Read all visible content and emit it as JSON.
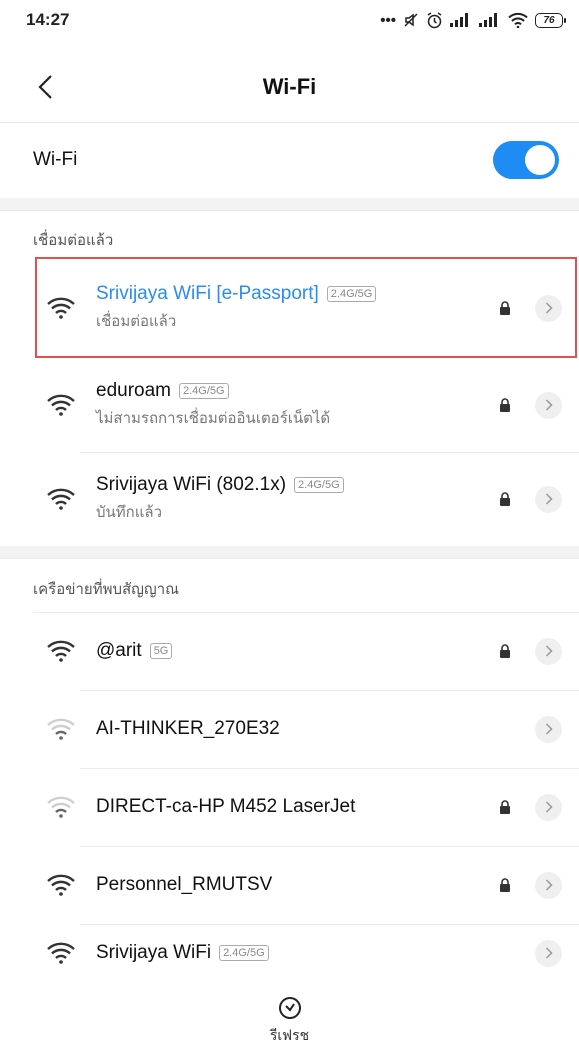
{
  "status_bar": {
    "time": "14:27",
    "battery": "76"
  },
  "header": {
    "title": "Wi-Fi"
  },
  "wifi_toggle": {
    "label": "Wi-Fi",
    "on": true
  },
  "sections": {
    "connected_title": "เชื่อมต่อแล้ว",
    "available_title": "เครือข่ายที่พบสัญญาณ"
  },
  "saved_networks": [
    {
      "name": "Srivijaya WiFi [e-Passport]",
      "badge": "2.4G/5G",
      "status": "เชื่อมต่อแล้ว",
      "locked": true,
      "connected": true,
      "signal": "strong"
    },
    {
      "name": "eduroam",
      "badge": "2.4G/5G",
      "status": "ไม่สามรถการเชื่อมต่ออินเตอร์เน็ตได้",
      "locked": true,
      "connected": false,
      "signal": "strong"
    },
    {
      "name": "Srivijaya WiFi (802.1x)",
      "badge": "2.4G/5G",
      "status": "บันทึกแล้ว",
      "locked": true,
      "connected": false,
      "signal": "strong"
    }
  ],
  "available_networks": [
    {
      "name": "@arit",
      "badge": "5G",
      "locked": true,
      "signal": "strong"
    },
    {
      "name": "AI-THINKER_270E32",
      "badge": "",
      "locked": false,
      "signal": "weak"
    },
    {
      "name": "DIRECT-ca-HP M452 LaserJet",
      "badge": "",
      "locked": true,
      "signal": "weak"
    },
    {
      "name": "Personnel_RMUTSV",
      "badge": "",
      "locked": true,
      "signal": "strong"
    },
    {
      "name": "Srivijaya WiFi",
      "badge": "2.4G/5G",
      "locked": false,
      "signal": "strong"
    }
  ],
  "bottom_bar": {
    "refresh_label": "รีเฟรช"
  },
  "colors": {
    "accent": "#2a8cf0",
    "switch_on": "#1e8cf2",
    "highlight": "#e05050"
  },
  "icons": {
    "back": "chevron-left-icon",
    "wifi": "wifi-icon",
    "lock": "lock-icon",
    "detail": "chevron-right-icon",
    "refresh": "refresh-icon"
  }
}
